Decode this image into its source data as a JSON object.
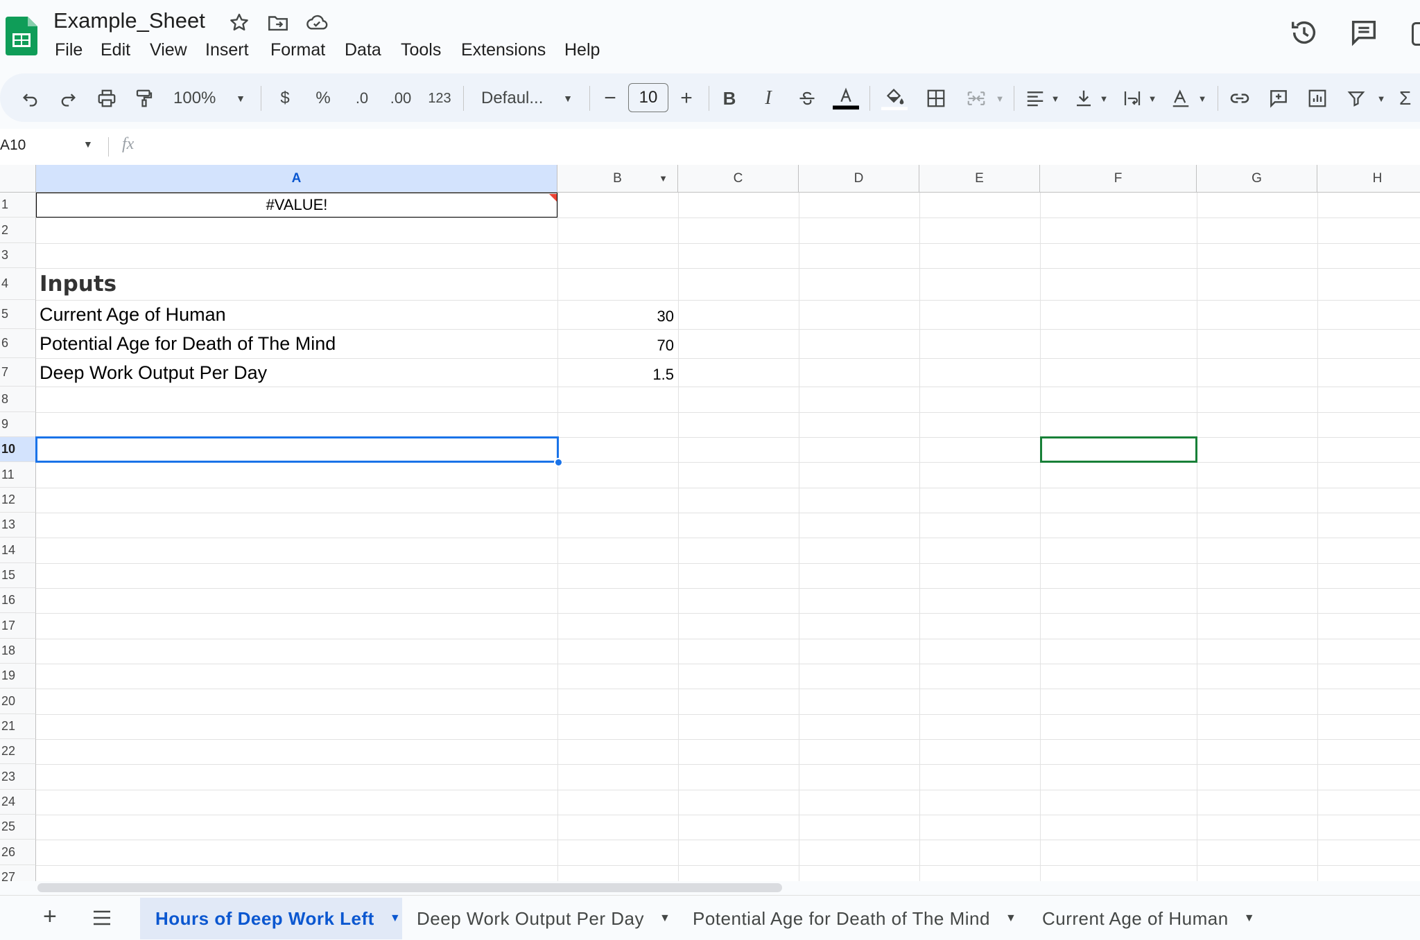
{
  "app": {
    "doc_title": "Example_Sheet",
    "menu": [
      "File",
      "Edit",
      "View",
      "Insert",
      "Format",
      "Data",
      "Tools",
      "Extensions",
      "Help"
    ]
  },
  "toolbar": {
    "zoom": "100%",
    "currency": "$",
    "percent": "%",
    "decrease_decimal": ".0",
    "increase_decimal": ".00",
    "number_format": "123",
    "font": "Defaul...",
    "font_size": "10",
    "bold": "B",
    "italic": "I"
  },
  "formula_bar": {
    "name_box": "A10",
    "fx": "fx",
    "content": ""
  },
  "columns": [
    "A",
    "B",
    "C",
    "D",
    "E",
    "F",
    "G",
    "H"
  ],
  "rows": [
    "1",
    "2",
    "3",
    "4",
    "5",
    "6",
    "7",
    "8",
    "9",
    "10",
    "11",
    "12",
    "13",
    "14",
    "15",
    "16",
    "17",
    "18",
    "19",
    "20",
    "21",
    "22",
    "23",
    "24",
    "25",
    "26",
    "27"
  ],
  "cells": {
    "A1": "#VALUE!",
    "A4": "Inputs",
    "A5": "Current Age of Human",
    "B5": "30",
    "A6": "Potential Age for Death of The Mind",
    "B6": "70",
    "A7": "Deep Work Output Per Day",
    "B7": "1.5"
  },
  "sheet_tabs": [
    "Hours of Deep Work Left",
    "Deep Work Output Per Day",
    "Potential Age for Death of The Mind",
    "Current Age of Human"
  ],
  "active_sheet": "Hours of Deep Work Left",
  "colors": {
    "accent": "#1a73e8",
    "sheets_green": "#188038",
    "selected_header": "#d3e3fd",
    "active_tab_bg": "#e1e9f7",
    "active_tab_text": "#0b57d0"
  }
}
